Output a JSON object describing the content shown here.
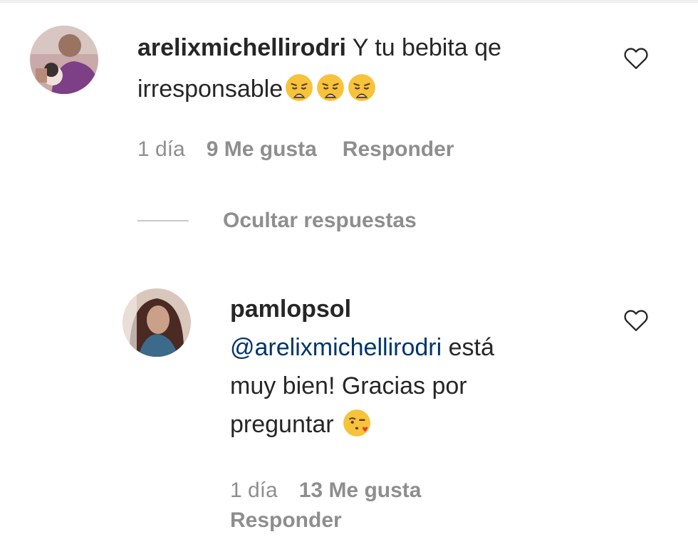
{
  "comments": [
    {
      "username": "arelixmichellirodri",
      "text": " Y tu bebita qe irresponsable",
      "emoji": [
        "weary-face-emoji",
        "weary-face-emoji",
        "weary-face-emoji"
      ],
      "time": "1 día",
      "likes": "9 Me gusta",
      "reply": "Responder"
    }
  ],
  "replies_toggle": "Ocultar respuestas",
  "replies": [
    {
      "username": "pamlopsol",
      "mention": "@arelixmichellirodri",
      "text_line1": " está",
      "text_line2": "muy bien! Gracias por",
      "text_line3": "preguntar",
      "emoji": "face-blowing-kiss-emoji",
      "time": "1 día",
      "likes": "13 Me gusta",
      "reply": "Responder"
    }
  ],
  "colors": {
    "text": "#262626",
    "secondary": "#8e8e8e",
    "mention": "#003569",
    "emoji": "#f6c33a"
  }
}
